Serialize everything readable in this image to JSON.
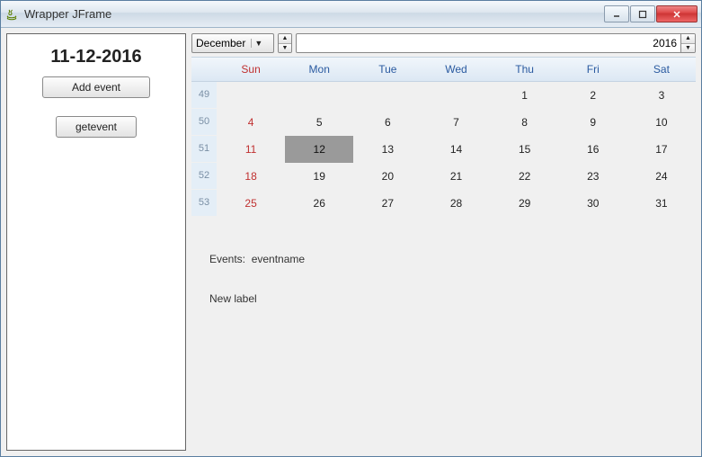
{
  "window": {
    "title": "Wrapper JFrame"
  },
  "sidebar": {
    "date": "11-12-2016",
    "add_event_label": "Add event",
    "get_event_label": "getevent"
  },
  "toolbar": {
    "month": "December",
    "year": "2016"
  },
  "calendar": {
    "headers": [
      "Sun",
      "Mon",
      "Tue",
      "Wed",
      "Thu",
      "Fri",
      "Sat"
    ],
    "weeks": [
      {
        "wk": "49",
        "days": [
          "",
          "",
          "",
          "",
          "1",
          "2",
          "3"
        ]
      },
      {
        "wk": "50",
        "days": [
          "4",
          "5",
          "6",
          "7",
          "8",
          "9",
          "10"
        ]
      },
      {
        "wk": "51",
        "days": [
          "11",
          "12",
          "13",
          "14",
          "15",
          "16",
          "17"
        ]
      },
      {
        "wk": "52",
        "days": [
          "18",
          "19",
          "20",
          "21",
          "22",
          "23",
          "24"
        ]
      },
      {
        "wk": "53",
        "days": [
          "25",
          "26",
          "27",
          "28",
          "29",
          "30",
          "31"
        ]
      }
    ],
    "selected_day": "12"
  },
  "events": {
    "label": "Events:",
    "value": "eventname",
    "new_label": "New label"
  }
}
